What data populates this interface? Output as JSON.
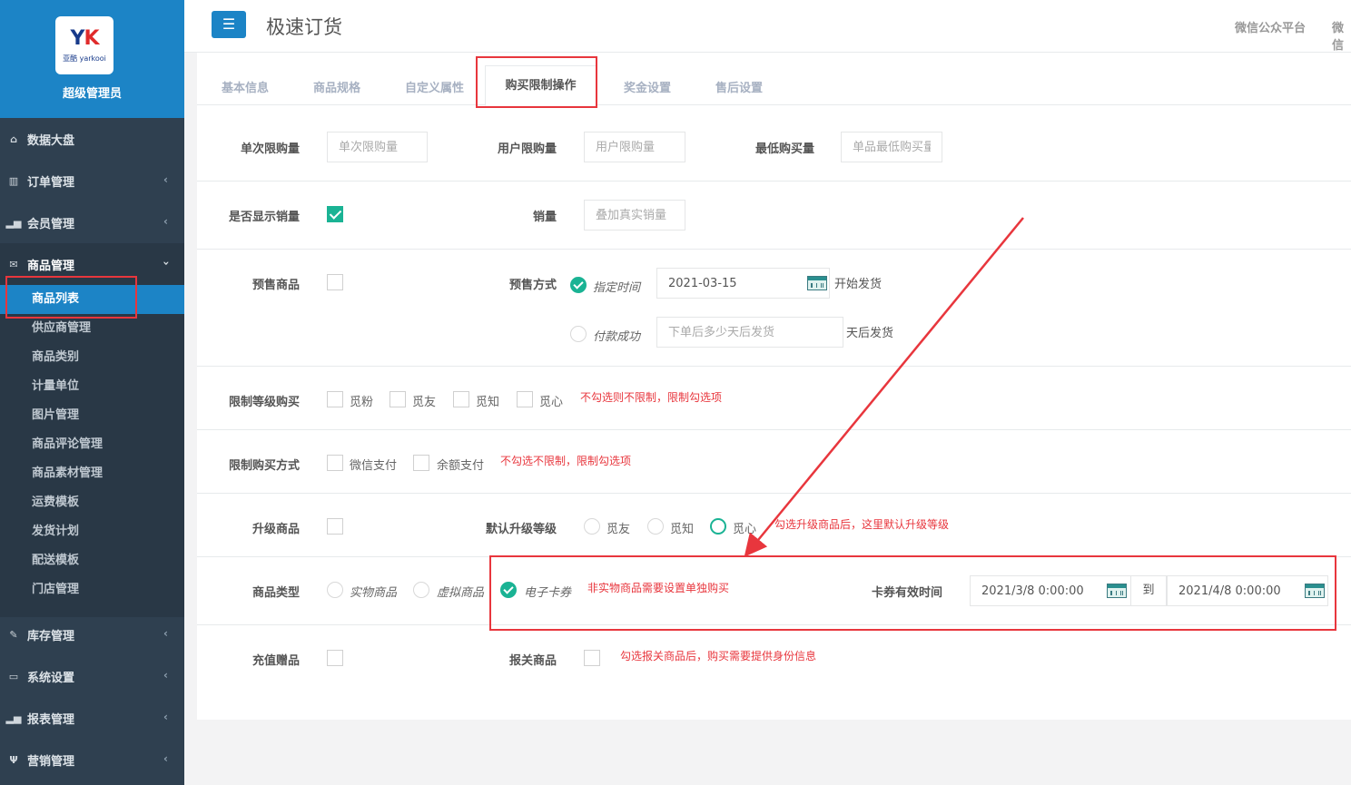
{
  "app": {
    "logo_text": "YK",
    "logo_sub": "亚酷 yarkooi",
    "role": "超级管理员",
    "menu_icon": "☰",
    "title": "极速订货",
    "top_links": [
      "微信公众平台",
      "微信"
    ]
  },
  "sidebar": {
    "items": [
      {
        "label": "数据大盘",
        "icon": "home-icon"
      },
      {
        "label": "订单管理",
        "icon": "order-icon"
      },
      {
        "label": "会员管理",
        "icon": "chart-icon"
      },
      {
        "label": "商品管理",
        "icon": "envelope-icon"
      },
      {
        "label": "库存管理",
        "icon": "edit-icon"
      },
      {
        "label": "系统设置",
        "icon": "monitor-icon"
      },
      {
        "label": "报表管理",
        "icon": "bar-chart-icon"
      },
      {
        "label": "营销管理",
        "icon": "cutlery-icon"
      }
    ],
    "submenu": [
      "商品列表",
      "供应商管理",
      "商品类别",
      "计量单位",
      "图片管理",
      "商品评论管理",
      "商品素材管理",
      "运费模板",
      "发货计划",
      "配送模板",
      "门店管理"
    ]
  },
  "tabs": [
    "基本信息",
    "商品规格",
    "自定义属性",
    "购买限制操作",
    "奖金设置",
    "售后设置"
  ],
  "form": {
    "single_limit": {
      "label": "单次限购量",
      "placeholder": "单次限购量"
    },
    "user_limit": {
      "label": "用户限购量",
      "placeholder": "用户限购量"
    },
    "min_buy": {
      "label": "最低购买量",
      "placeholder": "单品最低购买量"
    },
    "show_sales": {
      "label": "是否显示销量",
      "checked": true
    },
    "sales": {
      "label": "销量",
      "placeholder": "叠加真实销量"
    },
    "presale": {
      "label": "预售商品",
      "checked": false
    },
    "presale_mode": {
      "label": "预售方式",
      "opt1": "指定时间",
      "date": "2021-03-15",
      "suffix1": "开始发货",
      "opt2": "付款成功",
      "placeholder2": "下单后多少天后发货",
      "suffix2": "天后发货"
    },
    "level_limit": {
      "label": "限制等级购买",
      "options": [
        "觅粉",
        "觅友",
        "觅知",
        "觅心"
      ],
      "hint": "不勾选则不限制，限制勾选项"
    },
    "pay_limit": {
      "label": "限制购买方式",
      "options": [
        "微信支付",
        "余额支付"
      ],
      "hint": "不勾选不限制，限制勾选项"
    },
    "upgrade": {
      "label": "升级商品",
      "default_label": "默认升级等级",
      "options": [
        "觅友",
        "觅知",
        "觅心"
      ],
      "hint": "勾选升级商品后，这里默认升级等级"
    },
    "product_type": {
      "label": "商品类型",
      "options": [
        "实物商品",
        "虚拟商品",
        "电子卡券"
      ],
      "selected": "电子卡券",
      "hint": "非实物商品需要设置单独购买"
    },
    "coupon_valid": {
      "label": "卡券有效时间",
      "start": "2021/3/8 0:00:00",
      "to": "到",
      "end": "2021/4/8 0:00:00"
    },
    "recharge_gift": {
      "label": "充值赠品"
    },
    "customs": {
      "label": "报关商品",
      "hint": "勾选报关商品后，购买需要提供身份信息"
    }
  },
  "colors": {
    "sidebar": "#2f4050",
    "accent": "#1c84c6",
    "green": "#1ab394",
    "annotation": "#e8363d"
  }
}
